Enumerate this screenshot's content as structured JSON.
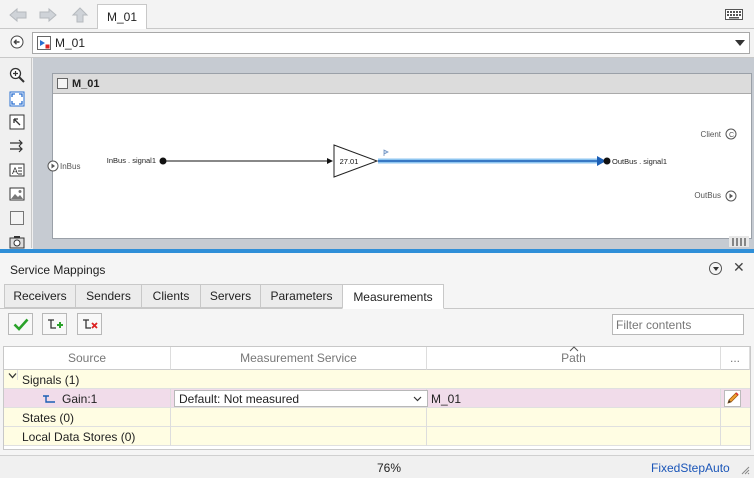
{
  "window": {
    "tab_label": "M_01",
    "address": "M_01"
  },
  "canvas": {
    "subsystem_title": "M_01",
    "inport_label": "InBus",
    "client_label": "Client",
    "outport_label": "OutBus",
    "signal_in_label": "InBus . signal1",
    "signal_out_label": "OutBus . signal1",
    "gain_value": "27.01"
  },
  "mapping": {
    "title": "Service Mappings",
    "tabs": [
      "Receivers",
      "Senders",
      "Clients",
      "Servers",
      "Parameters",
      "Measurements"
    ],
    "active_tab": "Measurements",
    "filter_placeholder": "Filter contents",
    "columns": {
      "source": "Source",
      "measurement_service": "Measurement Service",
      "path": "Path",
      "more": "..."
    },
    "rows": {
      "signals": "Signals (1)",
      "gain_source": "Gain:1",
      "gain_service": "Default: Not measured",
      "gain_path": "M_01",
      "states": "States (0)",
      "local_data_stores": "Local Data Stores (0)"
    }
  },
  "status": {
    "zoom": "76%",
    "solver": "FixedStepAuto"
  },
  "colors": {
    "selection_blue": "#2f8fd8",
    "row_yellow": "#fffde3",
    "row_pink": "#f1dcea",
    "solver_link": "#1a55b8"
  }
}
